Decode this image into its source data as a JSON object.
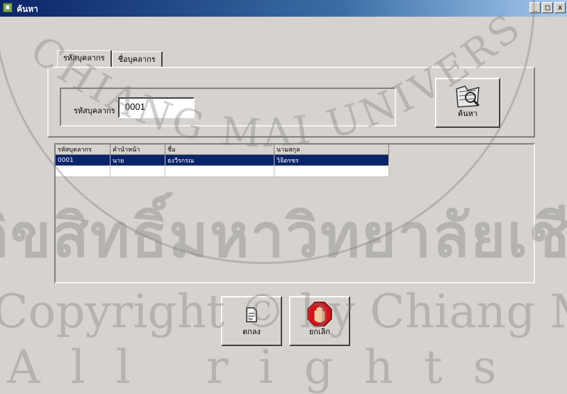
{
  "window": {
    "title": "ค้นหา",
    "controls": [
      "_",
      "□",
      "x"
    ]
  },
  "tabs": [
    {
      "label": "รหัสบุคลากร",
      "active": true
    },
    {
      "label": "ชื่อบุคลากร",
      "active": false
    }
  ],
  "search": {
    "field_label": "รหัสบุคลากร",
    "value": "0001",
    "button_label": "ค้นหา",
    "button_icon": "folder-search-icon"
  },
  "grid": {
    "columns": [
      "รหัสบุคลากร",
      "คำนำหน้า",
      "ชื่อ",
      "นามสกุล"
    ],
    "rows": [
      [
        "0001",
        "นาย",
        "ธงวีรกรณ",
        "วิจิตรชร"
      ],
      [
        "",
        "",
        "",
        ""
      ]
    ],
    "selected_row": 0
  },
  "buttons": {
    "ok_label": "ตกลง",
    "ok_icon": "document-icon",
    "cancel_label": "ยกเลิก",
    "cancel_icon": "stop-hand-icon"
  },
  "watermark": {
    "arc_text": "CHIANG MAI UNIVERSITY",
    "line1": "ลิขสิทธิ์มหาวิทยาลัยเชียงใหม่",
    "line2": "Copyright © by Chiang Mai University",
    "line3": "All rights reserved"
  },
  "colors": {
    "face": "#d6d3ce",
    "titlebar": "#0a246a",
    "selection": "#0a246a"
  }
}
